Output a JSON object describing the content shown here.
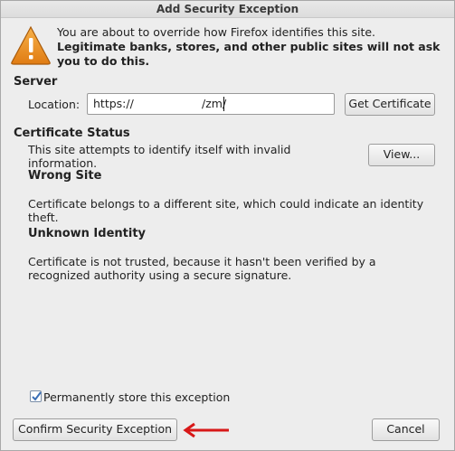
{
  "window": {
    "title": "Add Security Exception"
  },
  "intro": {
    "line1": "You are about to override how Firefox identifies this site.",
    "line2": "Legitimate banks, stores, and other public sites will not ask you to do this."
  },
  "server": {
    "heading": "Server",
    "location_label": "Location:",
    "location_prefix": "https://",
    "location_suffix": "/zm/",
    "get_certificate": "Get Certificate"
  },
  "status": {
    "heading": "Certificate Status",
    "summary": "This site attempts to identify itself with invalid information.",
    "view_button": "View...",
    "wrong_site_heading": "Wrong Site",
    "wrong_site_text": "Certificate belongs to a different site, which could indicate an identity theft.",
    "unknown_identity_heading": "Unknown Identity",
    "unknown_identity_text": "Certificate is not trusted, because it hasn't been verified by a recognized authority using a secure signature."
  },
  "footer": {
    "permanent_label": "Permanently store this exception",
    "permanent_checked": true,
    "confirm_button": "Confirm Security Exception",
    "cancel_button": "Cancel"
  },
  "icons": {
    "warning": "warning-triangle-icon",
    "checkmark": "checkmark-icon",
    "arrow": "red-arrow-icon"
  }
}
